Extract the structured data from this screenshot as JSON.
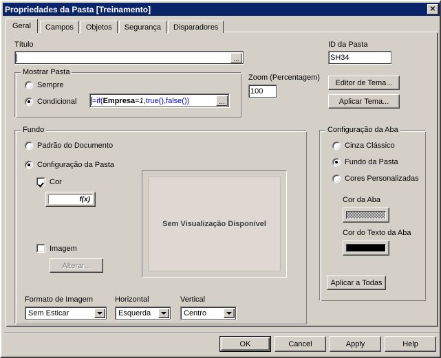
{
  "window": {
    "title": "Propriedades da Pasta [Treinamento]",
    "close_label": "✕",
    "titlebar_color": "#0a246a",
    "face_color": "#d4d0c8"
  },
  "tabs": [
    {
      "label": "Geral",
      "active": true
    },
    {
      "label": "Campos",
      "active": false
    },
    {
      "label": "Objetos",
      "active": false
    },
    {
      "label": "Segurança",
      "active": false
    },
    {
      "label": "Disparadores",
      "active": false
    }
  ],
  "general": {
    "titulo": {
      "label": "Título",
      "value": "",
      "ellipsis_label": "..."
    },
    "id_pasta": {
      "label": "ID da Pasta",
      "value": "SH34"
    },
    "zoom": {
      "label": "Zoom (Percentagem)",
      "value": "100"
    },
    "theme_buttons": {
      "editor": "Editor de Tema...",
      "aplicar": "Aplicar Tema..."
    },
    "mostrar_pasta": {
      "title": "Mostrar Pasta",
      "options": [
        {
          "label": "Sempre",
          "selected": false
        },
        {
          "label": "Condicional",
          "selected": true
        }
      ],
      "formula": {
        "prefix": "=if(",
        "field_name": "Empresa",
        "equals": "=",
        "number": "1",
        "comma1": ", ",
        "true_fn": "true()",
        "comma2": ",",
        "false_fn": "false()",
        "suffix": ")",
        "full_text": "=if(Empresa=1, true(),false())",
        "ellipsis_label": "..."
      }
    },
    "fundo": {
      "title": "Fundo",
      "options": [
        {
          "label": "Padrão do Documento",
          "selected": false
        },
        {
          "label": "Configuração da Pasta",
          "selected": true
        }
      ],
      "cor": {
        "label": "Cor",
        "checked": true,
        "fx_label": "f(x)"
      },
      "imagem": {
        "label": "Imagem",
        "checked": false,
        "alterar_label": "Alterar...",
        "alterar_disabled": true
      },
      "formato_imagem": {
        "label": "Formato de Imagem",
        "value": "Sem Esticar"
      },
      "horizontal": {
        "label": "Horizontal",
        "value": "Esquerda"
      },
      "vertical": {
        "label": "Vertical",
        "value": "Centro"
      },
      "preview": {
        "text": "Sem Visualização Disponível",
        "bg_color": "#ded7d2"
      }
    },
    "config_aba": {
      "title": "Configuração da Aba",
      "options": [
        {
          "label": "Cinza Clássico",
          "selected": false
        },
        {
          "label": "Fundo da Pasta",
          "selected": true
        },
        {
          "label": "Cores Personalizadas",
          "selected": false
        }
      ],
      "cor_da_aba": {
        "label": "Cor da Aba",
        "swatch": "checker"
      },
      "cor_texto_aba": {
        "label": "Cor do Texto da Aba",
        "swatch_color": "#000000"
      },
      "aplicar_todas": "Aplicar a Todas"
    }
  },
  "footer": {
    "buttons": [
      {
        "label": "OK",
        "default": true
      },
      {
        "label": "Cancel",
        "default": false
      },
      {
        "label": "Apply",
        "default": false
      },
      {
        "label": "Help",
        "default": false
      }
    ]
  }
}
